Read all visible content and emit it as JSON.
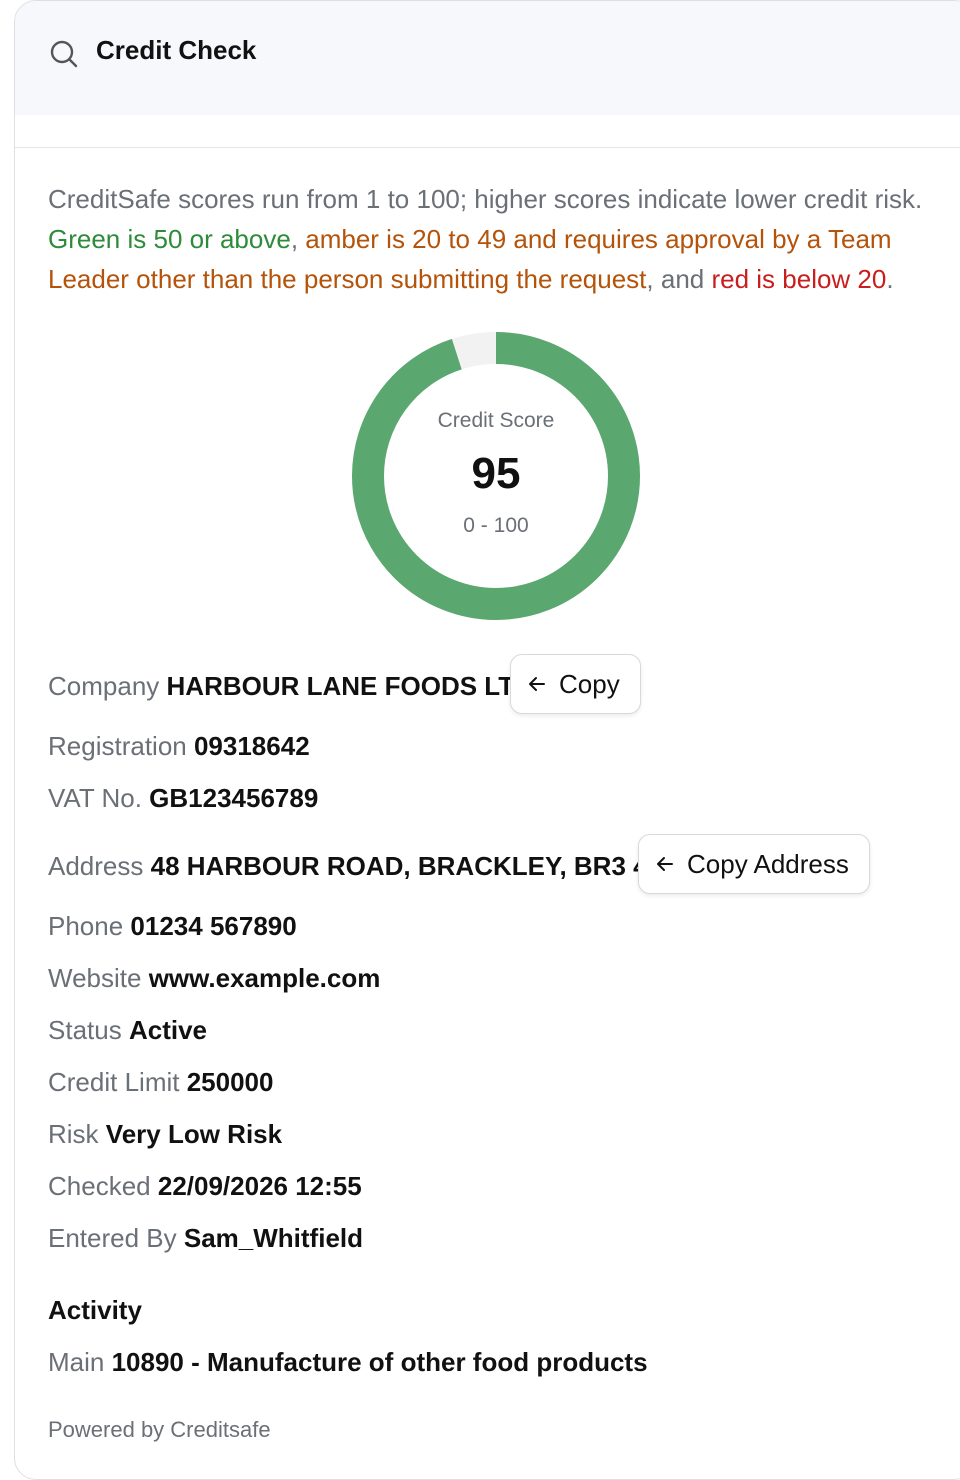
{
  "header": {
    "title": "Credit Check",
    "icon": "search-icon"
  },
  "intro": {
    "p1": "CreditSafe scores run from 1 to 100; higher scores indicate lower credit risk.",
    "green": "Green is 50 or above",
    "sep1": ", ",
    "amber": "amber is 20 to 49 and requires approval by a Team Leader other than the person submitting the request",
    "sep2": ", and ",
    "red": "red is below 20",
    "end": "."
  },
  "colors": {
    "green": "#2e8b3a",
    "amber": "#b45309",
    "red": "#c81e1e",
    "gauge_fill": "#5aa86f",
    "gauge_track": "#f2f2f2"
  },
  "score": {
    "caption": "Credit Score",
    "value": 95,
    "value_text": "95",
    "range_text": "0 - 100",
    "max": 100
  },
  "company": {
    "label": "Company",
    "value": "HARBOUR LANE FOODS LTD",
    "copy_label": "Copy"
  },
  "registration": {
    "label": "Registration",
    "value": "09318642"
  },
  "vat": {
    "label": "VAT No.",
    "value": "GB123456789"
  },
  "address": {
    "label": "Address",
    "value": "48 HARBOUR ROAD, BRACKLEY, BR3 4EF",
    "copy_label": "Copy Address"
  },
  "phone": {
    "label": "Phone",
    "value": "01234 567890"
  },
  "website": {
    "label": "Website",
    "value": "www.example.com"
  },
  "status": {
    "label": "Status",
    "value": "Active"
  },
  "credit_limit": {
    "label": "Credit Limit",
    "value": "250000"
  },
  "risk": {
    "label": "Risk",
    "value": "Very Low Risk"
  },
  "checked": {
    "label": "Checked",
    "value": "22/09/2026 12:55"
  },
  "entered_by": {
    "label": "Entered By",
    "value": "Sam_Whitfield"
  },
  "activity": {
    "heading": "Activity",
    "label": "Main",
    "value": "10890 - Manufacture of other food products"
  },
  "footer": {
    "text": "Powered by Creditsafe"
  }
}
